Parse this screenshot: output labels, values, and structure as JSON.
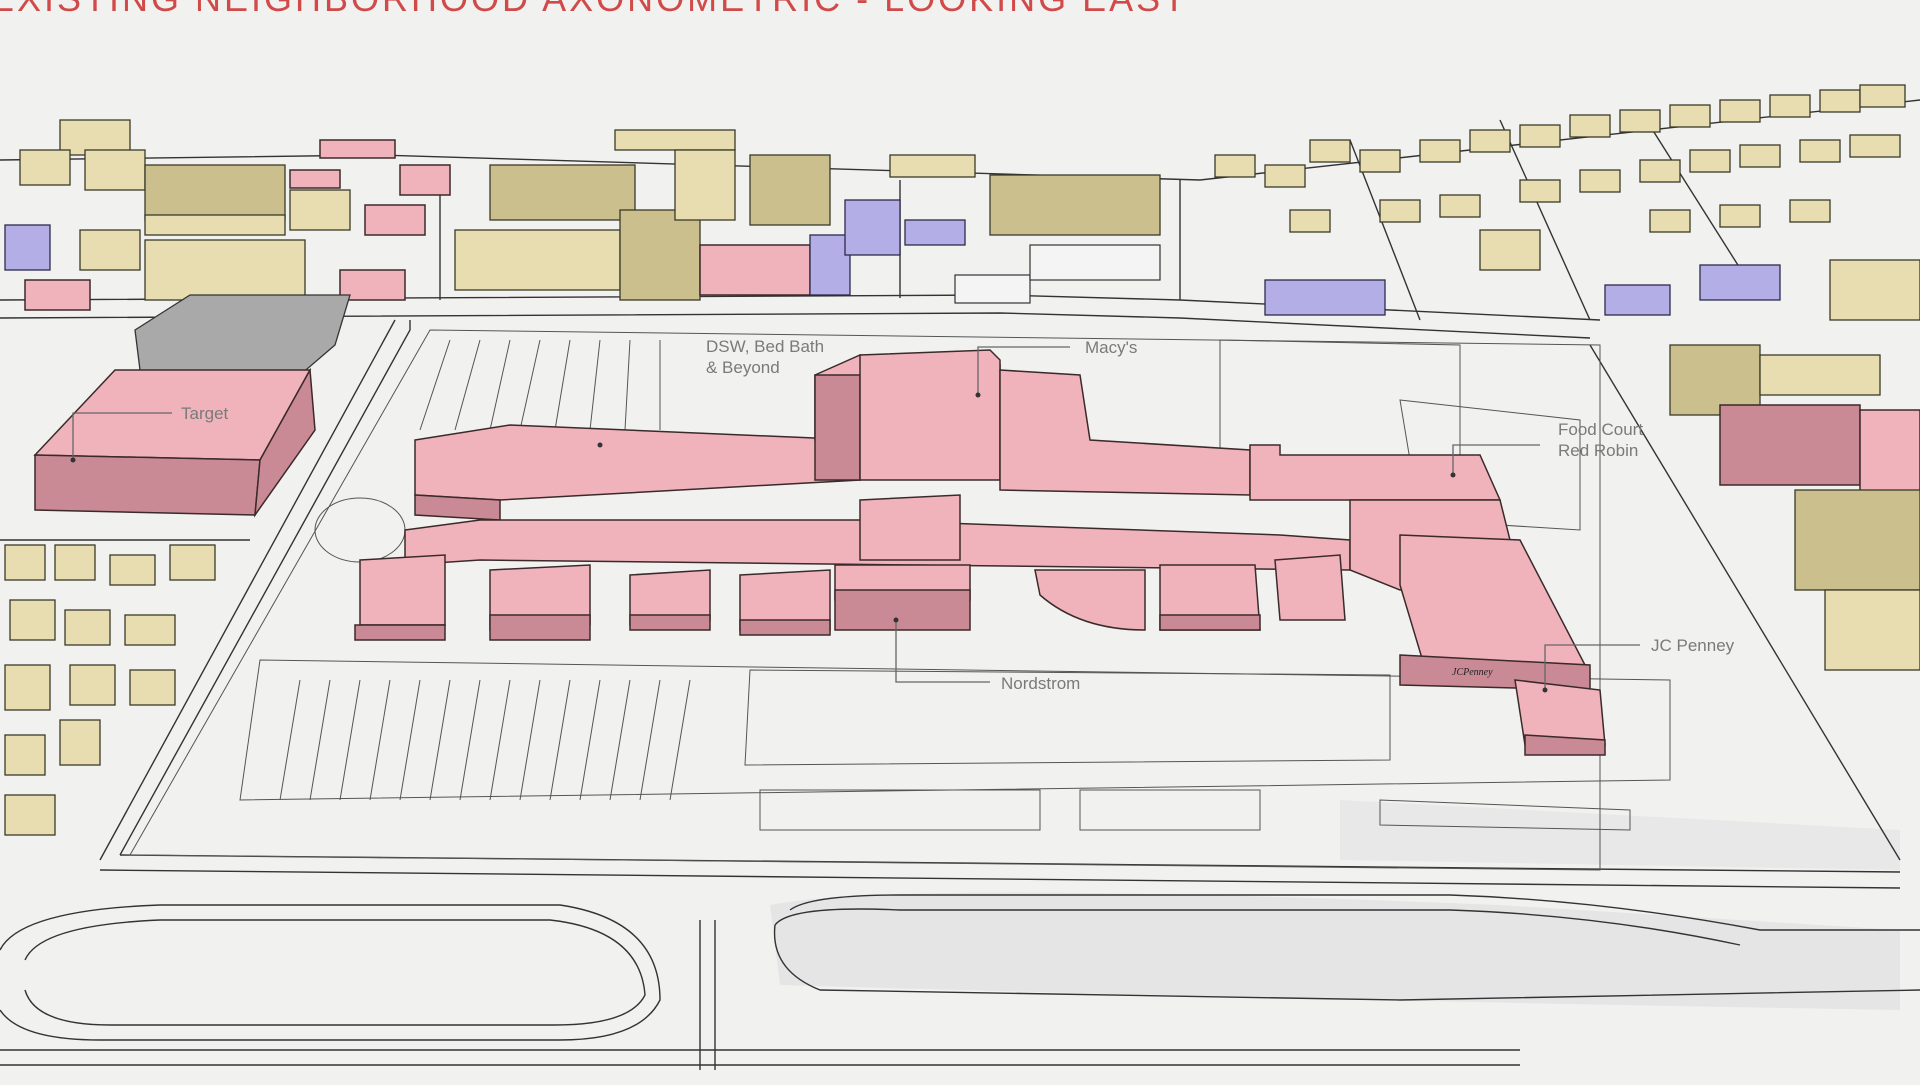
{
  "slide": {
    "title": "EXISTING NEIGHBORHOOD AXONOMETRIC - LOOKING EAST"
  },
  "labels": {
    "target": "Target",
    "dsw_line1": "DSW, Bed Bath",
    "dsw_line2": "& Beyond",
    "macys": "Macy's",
    "food_line1": "Food Court",
    "food_line2": "Red Robin",
    "nordstrom": "Nordstrom",
    "jcpenney": "JC Penney",
    "jcp_sign": "JCPenney"
  },
  "colors": {
    "mall": "#f0b3bc",
    "residential": "#e8ddb0",
    "civic": "#b4aee6",
    "title": "#d14a4a"
  }
}
